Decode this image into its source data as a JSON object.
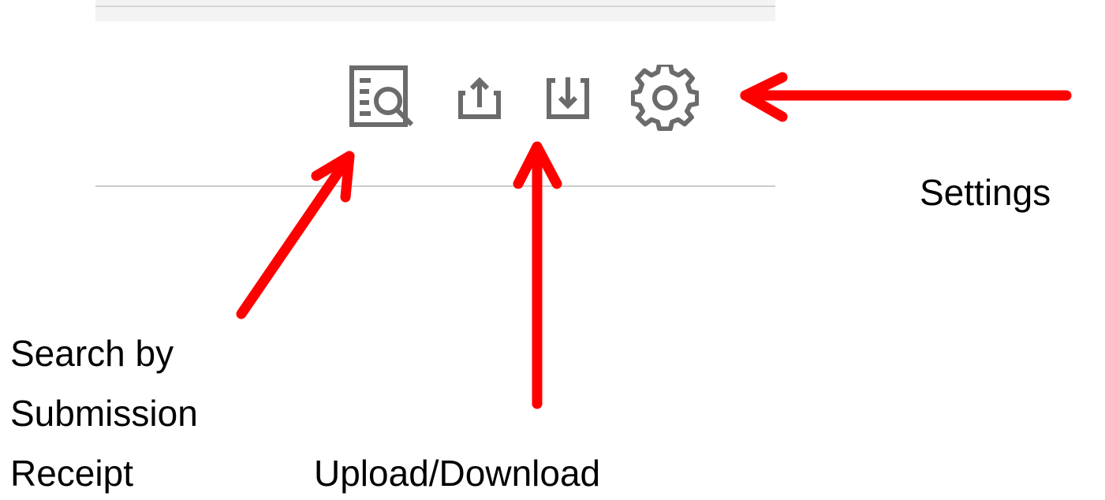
{
  "toolbar": {
    "buttons": [
      {
        "id": "search-receipt",
        "icon": "search-document-icon"
      },
      {
        "id": "upload",
        "icon": "upload-icon"
      },
      {
        "id": "download",
        "icon": "download-icon"
      },
      {
        "id": "settings",
        "icon": "gear-icon"
      }
    ],
    "icon_color": "#6b6b6b"
  },
  "annotations": {
    "color": "#ff0000",
    "settings_label": "Settings",
    "search_label_line1": "Search by",
    "search_label_line2": "Submission",
    "search_label_line3": "Receipt",
    "updown_label": "Upload/Download"
  }
}
